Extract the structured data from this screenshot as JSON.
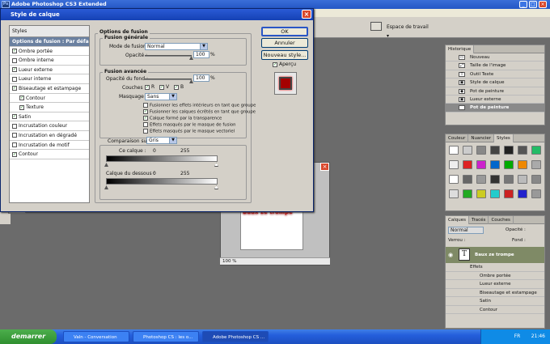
{
  "app": {
    "title": "Adobe Photoshop CS3 Extended",
    "icon_label": "Ps",
    "workspace_label": "Espace de travail"
  },
  "dialog": {
    "title": "Style de calque",
    "styles_header": "Styles",
    "style_items": [
      {
        "label": "Options de fusion : Par défaut",
        "checked": null,
        "selected": true,
        "sub": false
      },
      {
        "label": "Ombre portée",
        "checked": true,
        "selected": false,
        "sub": false
      },
      {
        "label": "Ombre interne",
        "checked": false,
        "selected": false,
        "sub": false
      },
      {
        "label": "Lueur externe",
        "checked": true,
        "selected": false,
        "sub": false
      },
      {
        "label": "Lueur interne",
        "checked": false,
        "selected": false,
        "sub": false
      },
      {
        "label": "Biseautage et estampage",
        "checked": true,
        "selected": false,
        "sub": false
      },
      {
        "label": "Contour",
        "checked": true,
        "selected": false,
        "sub": true
      },
      {
        "label": "Texture",
        "checked": true,
        "selected": false,
        "sub": true
      },
      {
        "label": "Satin",
        "checked": true,
        "selected": false,
        "sub": false
      },
      {
        "label": "Incrustation couleur",
        "checked": false,
        "selected": false,
        "sub": false
      },
      {
        "label": "Incrustation en dégradé",
        "checked": false,
        "selected": false,
        "sub": false
      },
      {
        "label": "Incrustation de motif",
        "checked": false,
        "selected": false,
        "sub": false
      },
      {
        "label": "Contour",
        "checked": true,
        "selected": false,
        "sub": false
      }
    ],
    "blend_options_title": "Options de fusion",
    "general_title": "Fusion générale",
    "blend_mode_label": "Mode de fusion :",
    "blend_mode_value": "Normal",
    "opacity_label": "Opacité :",
    "opacity_value": "100",
    "percent": "%",
    "advanced_title": "Fusion avancée",
    "fill_opacity_label": "Opacité du fond :",
    "fill_opacity_value": "100",
    "channels_label": "Couches :",
    "channel_r": "R",
    "channel_v": "V",
    "channel_b": "B",
    "knockout_label": "Masquage :",
    "knockout_value": "Sans",
    "adv_checks": [
      {
        "label": "Fusionner les effets intérieurs en tant que groupe",
        "checked": false
      },
      {
        "label": "Fusionner les calques écrêtés en tant que groupe",
        "checked": true
      },
      {
        "label": "Calque formé par la transparence",
        "checked": true
      },
      {
        "label": "Effets masqués par le masque de fusion",
        "checked": false
      },
      {
        "label": "Effets masqués par le masque vectoriel",
        "checked": false
      }
    ],
    "blend_if_label": "Comparaison sur :",
    "blend_if_value": "Gris",
    "this_layer_label": "Ce calque :",
    "underlying_label": "Calque du dessous :",
    "range_min": "0",
    "range_max": "255",
    "ok": "OK",
    "cancel": "Annuler",
    "new_style": "Nouveau style...",
    "preview_label": "Aperçu"
  },
  "document": {
    "text": "Baux ze trompe",
    "zoom": "100 %"
  },
  "history": {
    "tabs": [
      "Historique"
    ],
    "items": [
      {
        "label": "Nouveau",
        "icon": "doc-icon",
        "selected": false
      },
      {
        "label": "Taille de l'image",
        "icon": "resize-icon",
        "selected": false
      },
      {
        "label": "Outil Texte",
        "icon": "text-tool-icon",
        "selected": false
      },
      {
        "label": "Style de calque",
        "icon": "fx-icon",
        "selected": false
      },
      {
        "label": "Pot de peinture",
        "icon": "bucket-icon",
        "selected": false
      },
      {
        "label": "Lueur externe",
        "icon": "fx-icon",
        "selected": false
      },
      {
        "label": "Pot de peinture",
        "icon": "bucket-icon",
        "selected": true
      }
    ]
  },
  "styles_panel": {
    "tabs": [
      "Couleur",
      "Nuancier",
      "Styles"
    ]
  },
  "layers_panel": {
    "tabs": [
      "Calques",
      "Tracés",
      "Couches"
    ],
    "mode": "Normal",
    "opacity_label": "Opacité :",
    "lock_label": "Verrou :",
    "fill_label": "Fond :",
    "layer_name": "Baux ze trompe",
    "effects_label": "Effets",
    "effects": [
      "Ombre portée",
      "Lueur externe",
      "Biseautage et estampage",
      "Satin",
      "Contour"
    ]
  },
  "taskbar": {
    "start": "demarrer",
    "tasks": [
      {
        "label": "Valn - Conversation",
        "active": false
      },
      {
        "label": "Photoshop CS : les o...",
        "active": false
      },
      {
        "label": "Adobe Photoshop CS ...",
        "active": true
      }
    ],
    "tray_lang": "FR",
    "time": "21:46"
  }
}
